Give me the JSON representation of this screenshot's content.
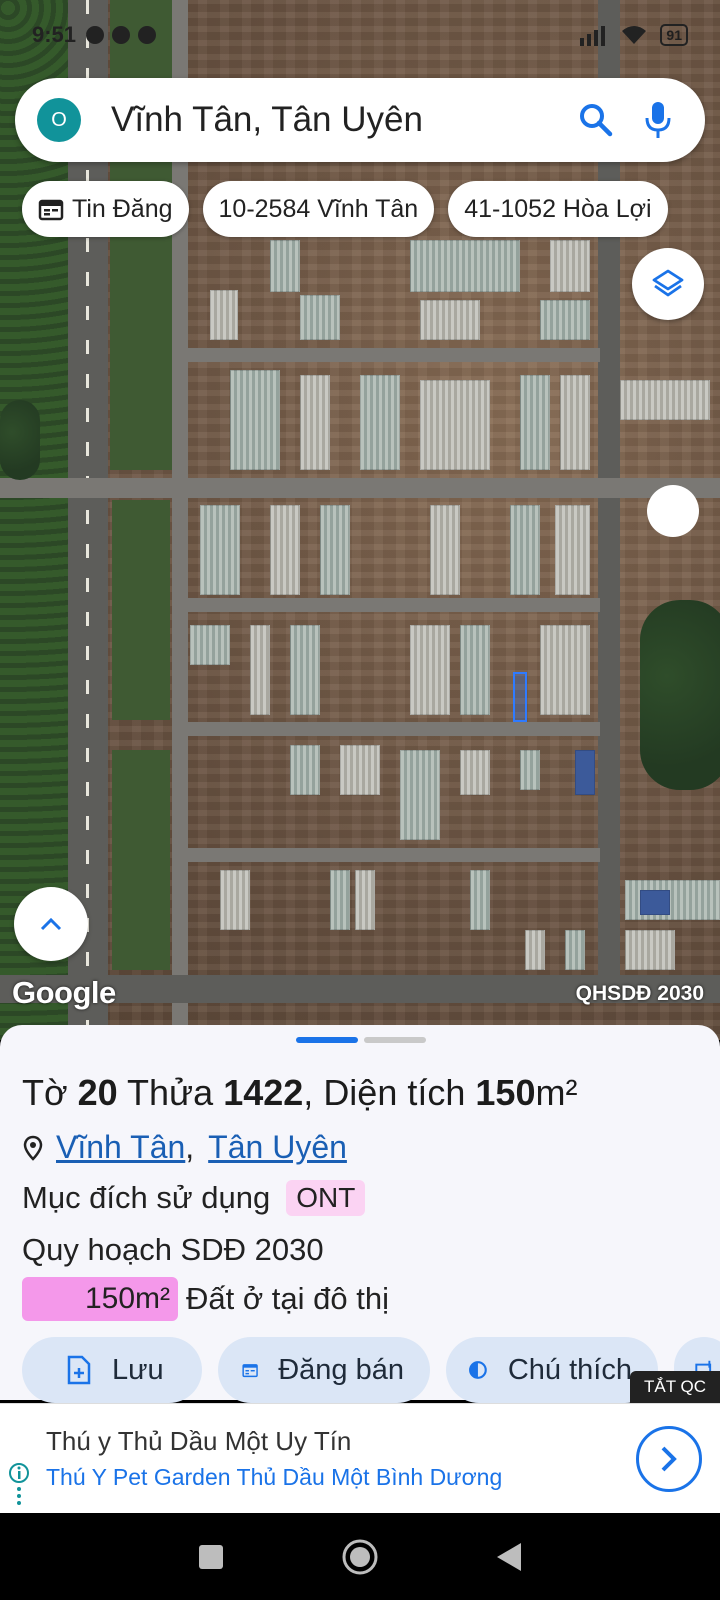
{
  "status_bar": {
    "time": "9:51",
    "battery": "91"
  },
  "search": {
    "avatar_letter": "O",
    "query": "Vĩnh Tân, Tân Uyên"
  },
  "chips": [
    {
      "label": "Tin Đăng",
      "icon": "calendar-icon"
    },
    {
      "label": "10-2584 Vĩnh Tân"
    },
    {
      "label": "41-1052 Hòa Lợi"
    }
  ],
  "map": {
    "attribution": "Google",
    "layer_label": "QHSDĐ 2030"
  },
  "parcel": {
    "sheet_word": "Tờ",
    "sheet_no": "20",
    "lot_word": "Thửa",
    "lot_no": "1422",
    "area_word": "Diện tích",
    "area_value": "150",
    "area_unit": "m²",
    "location": {
      "commune": "Vĩnh Tân",
      "district": "Tân Uyên"
    },
    "purpose_label": "Mục đích sử dụng",
    "purpose_code": "ONT",
    "plan_label": "Quy hoạch SDĐ 2030",
    "plan_area": "150m²",
    "plan_desc": "Đất ở tại đô thị",
    "plan_color": "#f498ea",
    "purpose_color": "#fbd3f3"
  },
  "actions": [
    {
      "label": "Lưu",
      "icon": "save-file-icon"
    },
    {
      "label": "Đăng bán",
      "icon": "calendar-icon"
    },
    {
      "label": "Chú thích",
      "icon": "contrast-icon"
    }
  ],
  "ad": {
    "close_label": "TẮT QC",
    "title": "Thú y Thủ Dầu Một Uy Tín",
    "subtitle": "Thú Y Pet Garden Thủ Dầu Một Bình Dương"
  },
  "colors": {
    "accent": "#1a73e8",
    "avatar": "#11939a"
  }
}
